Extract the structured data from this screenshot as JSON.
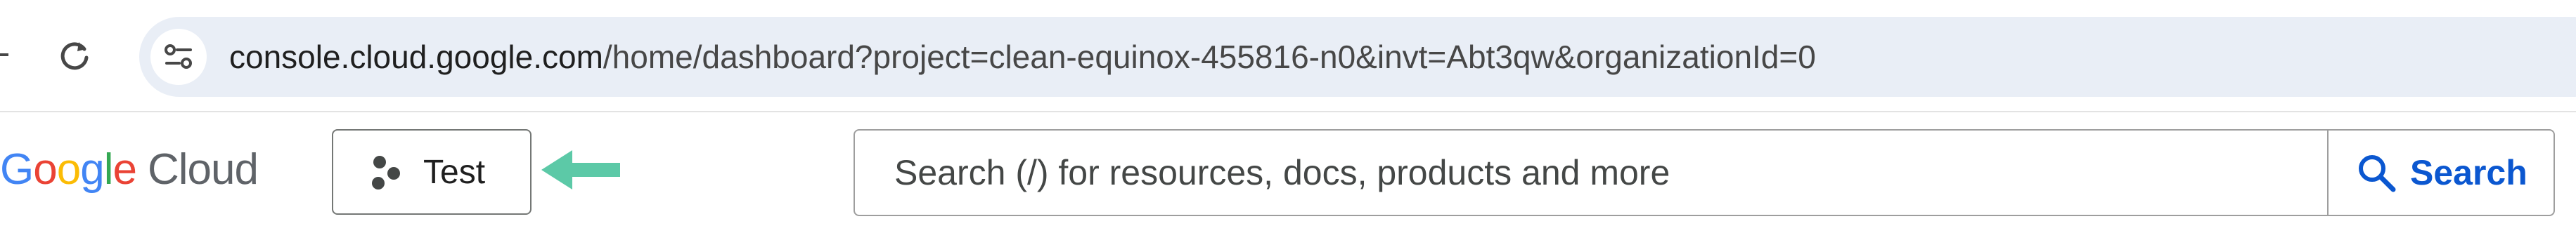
{
  "browser": {
    "url_host": "console.cloud.google.com",
    "url_path": "/home/dashboard?project=clean-equinox-455816-n0&invt=Abt3qw&organizationId=0"
  },
  "header": {
    "logo": {
      "letters": [
        "G",
        "o",
        "o",
        "g",
        "l",
        "e"
      ],
      "letter_colors": [
        "#4285F4",
        "#EA4335",
        "#FBBC05",
        "#4285F4",
        "#34A853",
        "#EA4335"
      ],
      "product": "Cloud"
    },
    "project_picker": {
      "label": "Test",
      "icon": "project-dots-icon"
    },
    "search": {
      "placeholder": "Search (/) for resources, docs, products and more",
      "value": "",
      "button_label": "Search",
      "icon": "search-icon"
    }
  },
  "annotation": {
    "arrow_color": "#5cc9a7",
    "arrow_direction": "left"
  },
  "colors": {
    "accent_blue": "#0b57d0",
    "omnibox_bg": "#e9eef6"
  }
}
